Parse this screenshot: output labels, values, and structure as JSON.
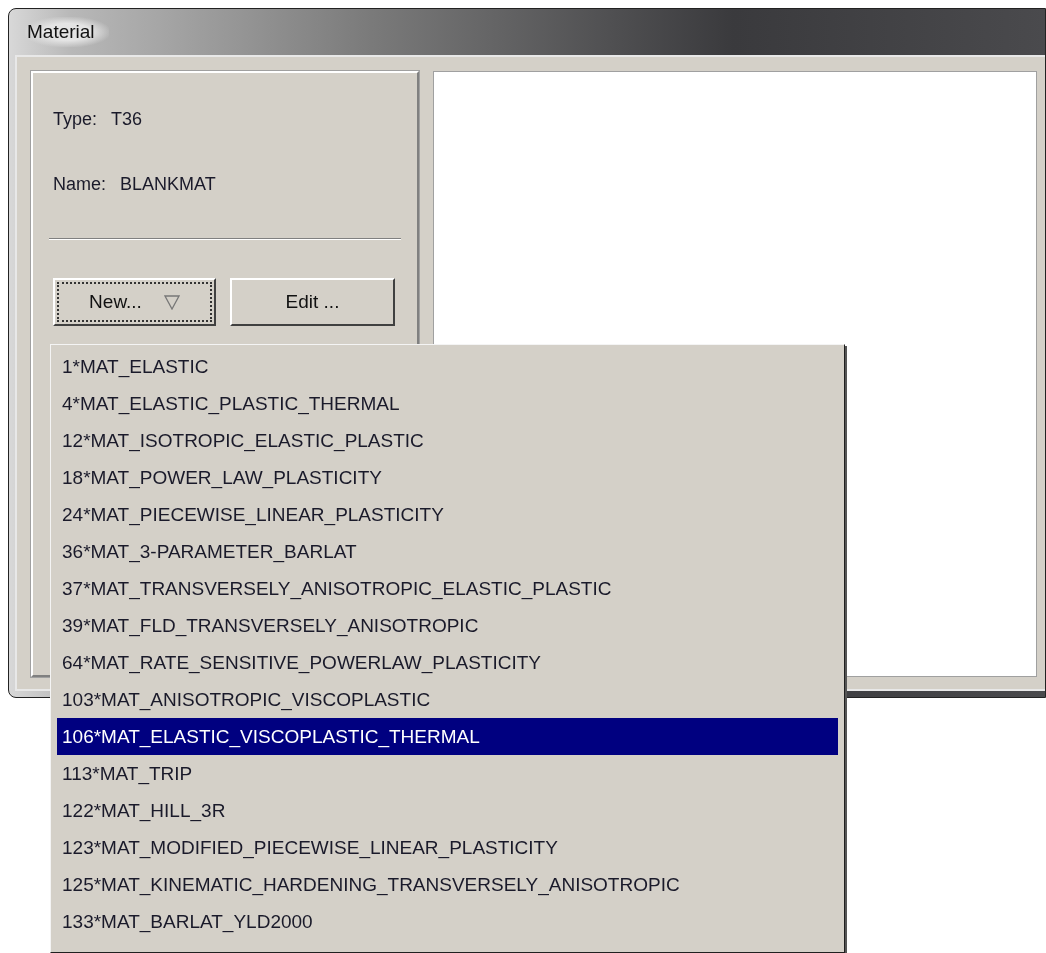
{
  "window": {
    "title": "Material"
  },
  "info": {
    "type_label": "Type:",
    "type_value": "T36",
    "name_label": "Name:",
    "name_value": "BLANKMAT"
  },
  "buttons": [
    {
      "label": "New...",
      "kind": "dropdown",
      "focused": true
    },
    {
      "label": "Edit ...",
      "kind": "plain",
      "focused": false
    }
  ],
  "menu": {
    "items": [
      {
        "label": "1*MAT_ELASTIC",
        "selected": false
      },
      {
        "label": "4*MAT_ELASTIC_PLASTIC_THERMAL",
        "selected": false
      },
      {
        "label": "12*MAT_ISOTROPIC_ELASTIC_PLASTIC",
        "selected": false
      },
      {
        "label": "18*MAT_POWER_LAW_PLASTICITY",
        "selected": false
      },
      {
        "label": "24*MAT_PIECEWISE_LINEAR_PLASTICITY",
        "selected": false
      },
      {
        "label": "36*MAT_3-PARAMETER_BARLAT",
        "selected": false
      },
      {
        "label": "37*MAT_TRANSVERSELY_ANISOTROPIC_ELASTIC_PLASTIC",
        "selected": false
      },
      {
        "label": "39*MAT_FLD_TRANSVERSELY_ANISOTROPIC",
        "selected": false
      },
      {
        "label": "64*MAT_RATE_SENSITIVE_POWERLAW_PLASTICITY",
        "selected": false
      },
      {
        "label": "103*MAT_ANISOTROPIC_VISCOPLASTIC",
        "selected": false
      },
      {
        "label": "106*MAT_ELASTIC_VISCOPLASTIC_THERMAL",
        "selected": true
      },
      {
        "label": "113*MAT_TRIP",
        "selected": false
      },
      {
        "label": "122*MAT_HILL_3R",
        "selected": false
      },
      {
        "label": "123*MAT_MODIFIED_PIECEWISE_LINEAR_PLASTICITY",
        "selected": false
      },
      {
        "label": "125*MAT_KINEMATIC_HARDENING_TRANSVERSELY_ANISOTROPIC",
        "selected": false
      },
      {
        "label": "133*MAT_BARLAT_YLD2000",
        "selected": false
      }
    ]
  }
}
